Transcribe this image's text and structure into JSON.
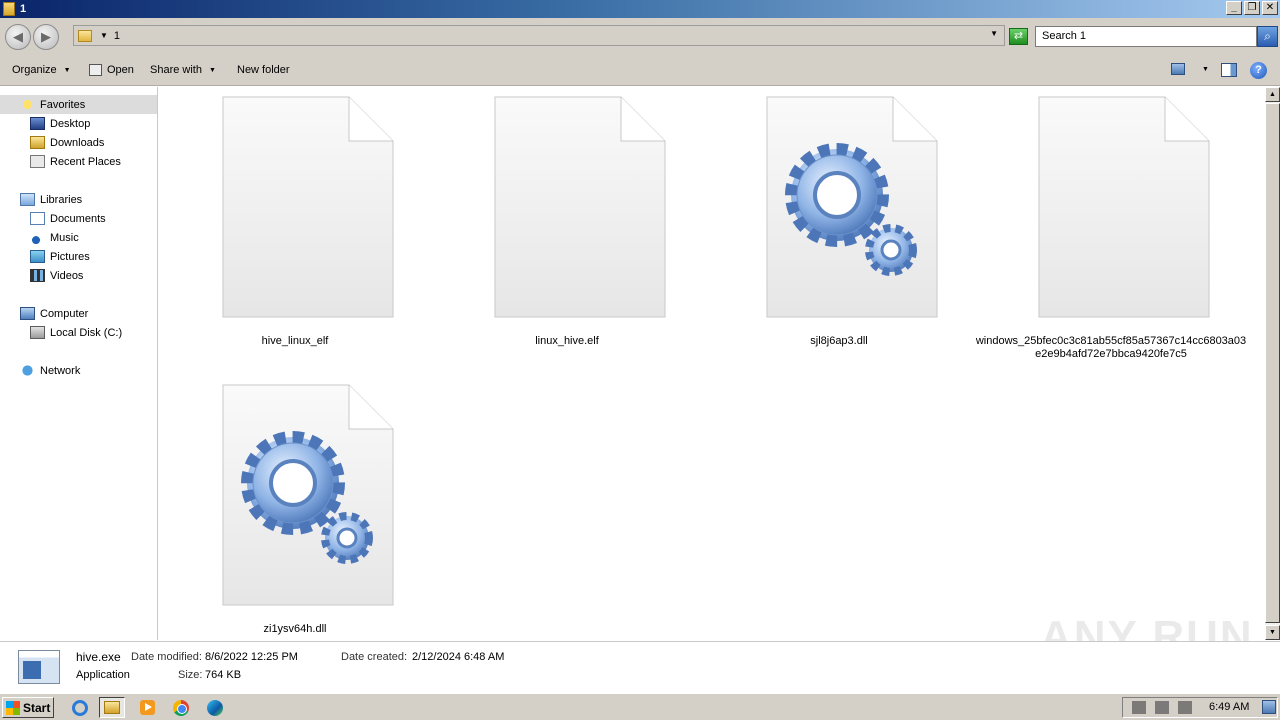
{
  "window": {
    "title": "1"
  },
  "address": {
    "path": "1",
    "search_placeholder": "Search 1"
  },
  "toolbar": {
    "organize": "Organize",
    "open": "Open",
    "share_with": "Share with",
    "new_folder": "New folder"
  },
  "nav": {
    "favorites": "Favorites",
    "desktop": "Desktop",
    "downloads": "Downloads",
    "recent_places": "Recent Places",
    "libraries": "Libraries",
    "documents": "Documents",
    "music": "Music",
    "pictures": "Pictures",
    "videos": "Videos",
    "computer": "Computer",
    "local_disk": "Local Disk (C:)",
    "network": "Network"
  },
  "files": [
    {
      "name": "hive_linux_elf",
      "icon": "generic-file-icon"
    },
    {
      "name": "linux_hive.elf",
      "icon": "generic-file-icon"
    },
    {
      "name": "sjl8j6ap3.dll",
      "icon": "dll-gear-file-icon"
    },
    {
      "name": "windows_25bfec0c3c81ab55cf85a57367c14cc6803a03e2e9b4afd72e7bbca9420fe7c5",
      "icon": "generic-file-icon"
    },
    {
      "name": "zi1ysv64h.dll",
      "icon": "dll-gear-file-icon"
    }
  ],
  "details": {
    "name": "hive.exe",
    "type": "Application",
    "date_modified_label": "Date modified:",
    "date_modified": "8/6/2022 12:25 PM",
    "size_label": "Size:",
    "size": "764 KB",
    "date_created_label": "Date created:",
    "date_created": "2/12/2024 6:48 AM"
  },
  "taskbar": {
    "start": "Start",
    "clock": "6:49 AM"
  },
  "watermark": "ANY RUN"
}
